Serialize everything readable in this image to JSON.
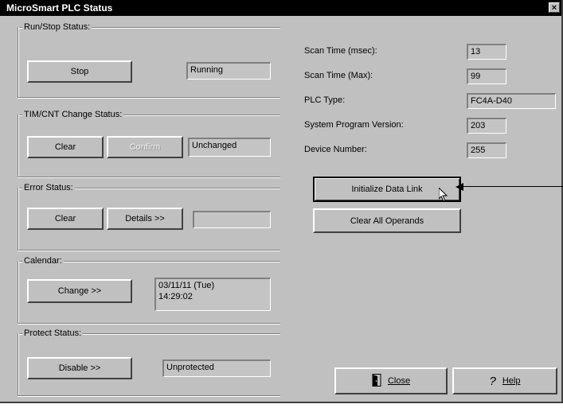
{
  "window": {
    "title": "MicroSmart PLC Status",
    "close_glyph": "×"
  },
  "run_stop": {
    "legend": "Run/Stop Status:",
    "button": "Stop",
    "value": "Running"
  },
  "tim_cnt": {
    "legend": "TIM/CNT Change Status:",
    "clear_button": "Clear",
    "confirm_button": "Confirm",
    "value": "Unchanged"
  },
  "error_status": {
    "legend": "Error Status:",
    "clear_button": "Clear",
    "details_button": "Details >>",
    "value": ""
  },
  "calendar": {
    "legend": "Calendar:",
    "change_button": "Change >>",
    "value": "03/11/11 (Tue)\n14:29:02"
  },
  "protect": {
    "legend": "Protect Status:",
    "disable_button": "Disable >>",
    "value": "Unprotected"
  },
  "info": {
    "scan_time_msec_label": "Scan Time (msec):",
    "scan_time_msec_value": "13",
    "scan_time_max_label": "Scan Time (Max):",
    "scan_time_max_value": "99",
    "plc_type_label": "PLC Type:",
    "plc_type_value": "FC4A-D40",
    "system_program_version_label": "System Program Version:",
    "system_program_version_value": "203",
    "device_number_label": "Device Number:",
    "device_number_value": "255"
  },
  "actions": {
    "initialize_data_link": "Initialize Data Link",
    "clear_all_operands": "Clear All Operands",
    "close": "Close",
    "help": "Help"
  },
  "icons": {
    "close_icon": "door-icon",
    "help_icon": "question-mark-icon",
    "cursor": "mouse-pointer-icon"
  }
}
